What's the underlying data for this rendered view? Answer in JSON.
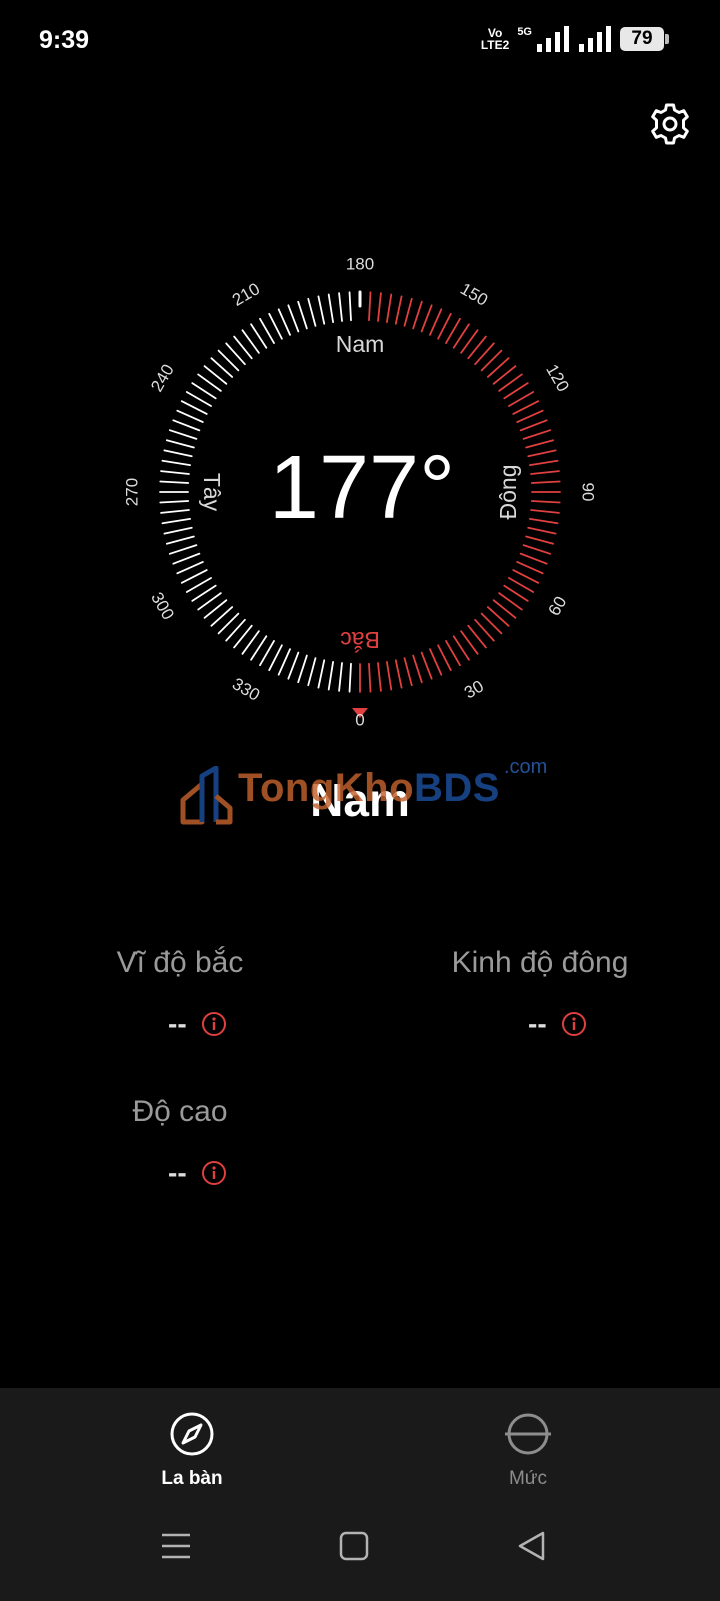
{
  "status_bar": {
    "time": "9:39",
    "volte_line1": "Vo",
    "volte_line2": "LTE2",
    "network": "5G",
    "battery": "79"
  },
  "compass": {
    "heading_deg": 177,
    "heading_text": "177°",
    "tick_labels": [
      "0",
      "30",
      "60",
      "90",
      "120",
      "150",
      "180",
      "210",
      "240",
      "270",
      "300",
      "330"
    ],
    "cardinals": {
      "north": "Bắc",
      "south": "Nam",
      "east": "Đông",
      "west": "Tây"
    },
    "colors": {
      "highlight": "#e0403f",
      "tick": "#ffffff"
    }
  },
  "direction_name": "Nam",
  "watermark": {
    "part1": "Tong",
    "part2": "Kho",
    "part3": "BDS",
    "suffix": ".com"
  },
  "location": {
    "latitude": {
      "label": "Vĩ độ bắc",
      "value": "--"
    },
    "longitude": {
      "label": "Kinh độ đông",
      "value": "--"
    },
    "altitude": {
      "label": "Độ cao",
      "value": "--"
    }
  },
  "bottom_nav": {
    "tabs": [
      {
        "label": "La bàn",
        "active": true
      },
      {
        "label": "Mức",
        "active": false
      }
    ]
  },
  "icons": {
    "settings": "gear-icon",
    "info": "info-icon",
    "compass_tab": "compass-icon",
    "level_tab": "level-icon",
    "menu": "menu-icon",
    "home": "home-icon",
    "back": "back-icon"
  }
}
